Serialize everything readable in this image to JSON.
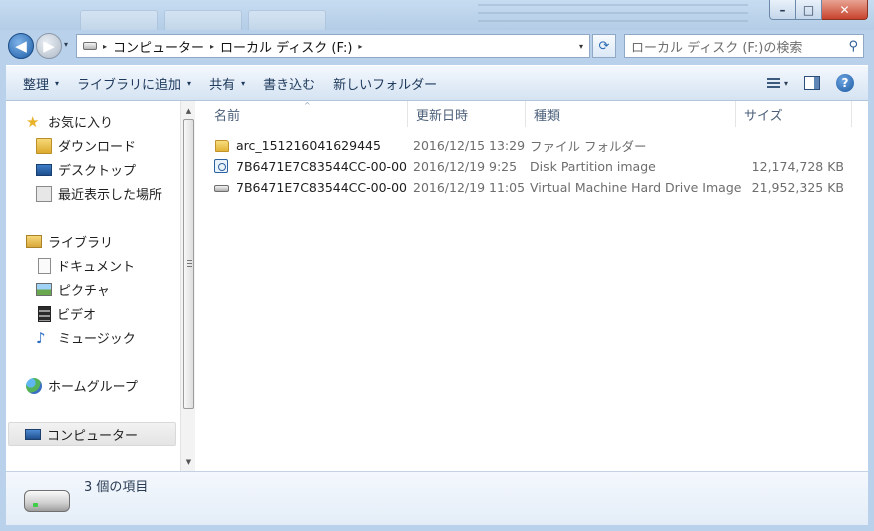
{
  "window": {
    "minimize_glyph": "–",
    "maximize_glyph": "□",
    "close_glyph": "✕"
  },
  "address": {
    "breadcrumbs": [
      "コンピューター",
      "ローカル ディスク (F:)"
    ],
    "separator_glyph": "▸",
    "dropdown_glyph": "▾",
    "refresh_glyph": "⟳"
  },
  "search": {
    "placeholder": "ローカル ディスク (F:)の検索",
    "icon": "search-icon"
  },
  "nav_buttons": {
    "back_glyph": "◀",
    "forward_glyph": "▶",
    "history_glyph": "▾"
  },
  "toolbar": {
    "organize": "整理",
    "add_to_library": "ライブラリに追加",
    "share": "共有",
    "burn": "書き込む",
    "new_folder": "新しいフォルダー",
    "dropdown_glyph": "▾",
    "help_glyph": "?"
  },
  "sidebar": {
    "favorites": {
      "label": "お気に入り",
      "items": [
        "ダウンロード",
        "デスクトップ",
        "最近表示した場所"
      ]
    },
    "libraries": {
      "label": "ライブラリ",
      "items": [
        "ドキュメント",
        "ピクチャ",
        "ビデオ",
        "ミュージック"
      ]
    },
    "homegroup": "ホームグループ",
    "computer": "コンピューター",
    "scroll_up_glyph": "▲",
    "scroll_down_glyph": "▼"
  },
  "columns": {
    "name": "名前",
    "date": "更新日時",
    "type": "種類",
    "size": "サイズ",
    "sort_glyph": "^"
  },
  "files": [
    {
      "name": "arc_151216041629445",
      "date": "2016/12/15 13:29",
      "type": "ファイル フォルダー",
      "size": "",
      "icon": "folder-icon"
    },
    {
      "name": "7B6471E7C83544CC-00-00",
      "date": "2016/12/19 9:25",
      "type": "Disk Partition image",
      "size": "12,174,728 KB",
      "icon": "disk-image-icon"
    },
    {
      "name": "7B6471E7C83544CC-00-00",
      "date": "2016/12/19 11:05",
      "type": "Virtual Machine Hard Drive Image",
      "size": "21,952,325 KB",
      "icon": "hard-drive-icon"
    }
  ],
  "details": {
    "item_count": "3 個の項目"
  },
  "colors": {
    "accent": "#1d5ea7",
    "frame": "#b9d1ea",
    "selected_nav": "#e4e4e4"
  }
}
